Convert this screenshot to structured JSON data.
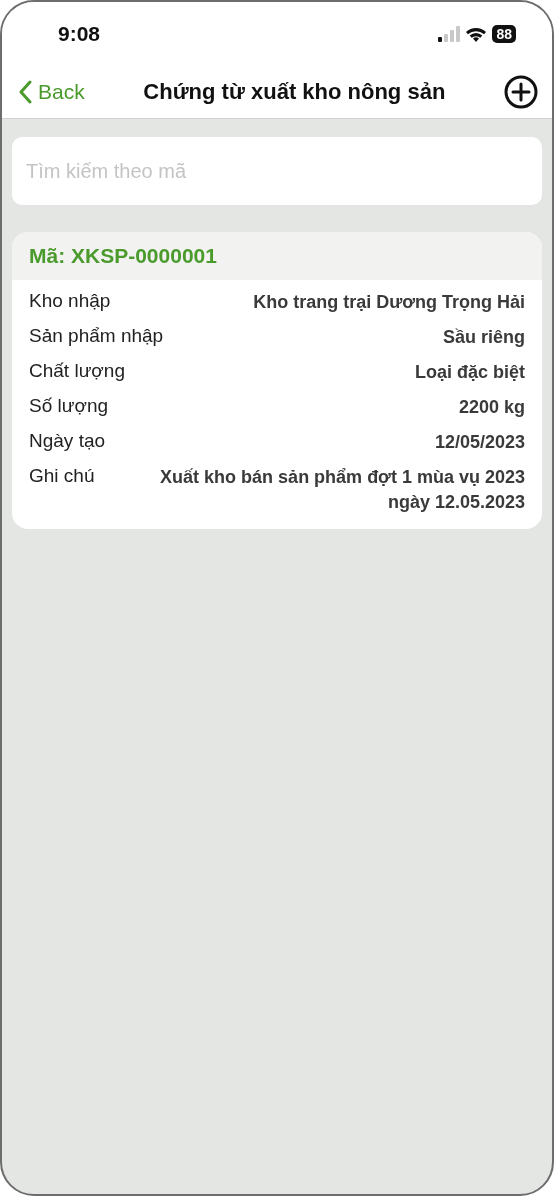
{
  "status_bar": {
    "time": "9:08",
    "battery": "88"
  },
  "nav": {
    "back": "Back",
    "title": "Chứng từ xuất kho nông sản"
  },
  "search": {
    "placeholder": "Tìm kiếm theo mã"
  },
  "records": [
    {
      "code": "Mã: XKSP-0000001",
      "fields": [
        {
          "label": "Kho nhập",
          "value": "Kho trang trại Dương Trọng Hải"
        },
        {
          "label": "Sản phẩm nhập",
          "value": "Sầu riêng"
        },
        {
          "label": "Chất lượng",
          "value": "Loại đặc biệt"
        },
        {
          "label": "Số lượng",
          "value": "2200 kg"
        },
        {
          "label": "Ngày tạo",
          "value": "12/05/2023"
        },
        {
          "label": "Ghi chú",
          "value": "Xuất kho bán sản phẩm đợt 1 mùa vụ 2023 ngày 12.05.2023"
        }
      ]
    }
  ]
}
